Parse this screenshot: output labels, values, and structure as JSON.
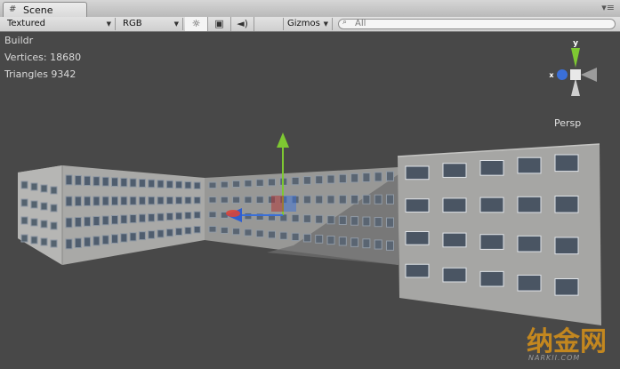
{
  "tab": {
    "title": "Scene",
    "icon": "scene-grid-icon"
  },
  "window_menu": {
    "icon": "window-menu-icon",
    "glyph": "▾≡"
  },
  "toolbar": {
    "shading_mode": "Textured",
    "render_mode": "RGB",
    "lighting_glyph": "☼",
    "image_glyph": "▣",
    "audio_glyph": "◄)",
    "gizmos_label": "Gizmos",
    "search_placeholder": "All",
    "search_glyph": "⌕"
  },
  "stats": {
    "object_name": "Buildr",
    "vertices": "Vertices: 18680",
    "triangles": "Triangles 9342"
  },
  "view_gizmo": {
    "y_label": "y",
    "x_label": "x",
    "projection": "Persp"
  },
  "watermark": {
    "text": "纳金网",
    "subtext": "NARKII.COM"
  },
  "colors": {
    "viewport_bg": "#484848",
    "y_axis": "#7ec832",
    "x_axis": "#d8453a",
    "z_axis": "#3a6fd8",
    "building_wall": "#a9a9a7"
  }
}
